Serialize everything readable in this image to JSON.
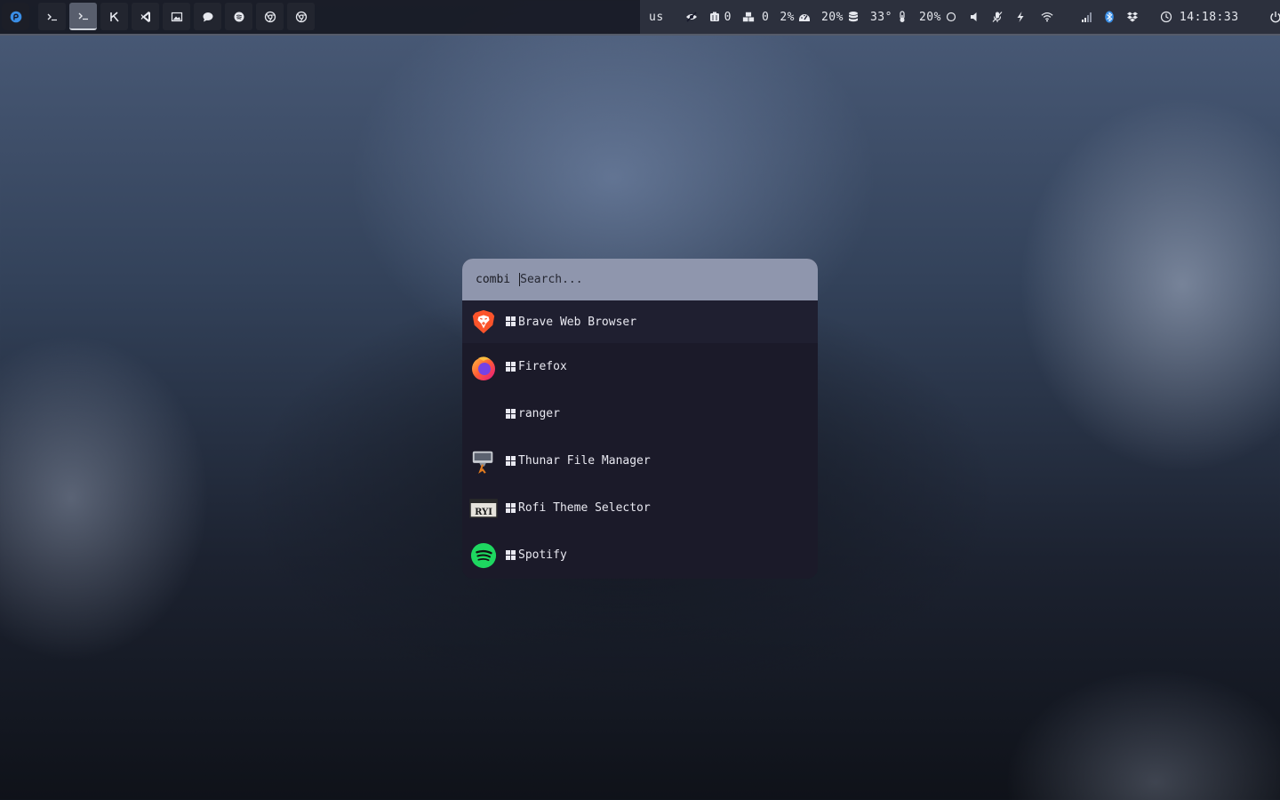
{
  "topbar": {
    "workspaces": [
      {
        "name": "terminal-icon",
        "active": false
      },
      {
        "name": "terminal-icon",
        "active": true
      },
      {
        "name": "kde-connect-icon",
        "active": false
      },
      {
        "name": "vscode-icon",
        "active": false
      },
      {
        "name": "image-icon",
        "active": false
      },
      {
        "name": "chat-icon",
        "active": false
      },
      {
        "name": "spotify-icon",
        "active": false
      },
      {
        "name": "chrome-icon",
        "active": false
      },
      {
        "name": "chrome-icon",
        "active": false
      }
    ],
    "status": {
      "keyboard_layout": "us",
      "hidden_count": "",
      "updates": "0",
      "packages": "0",
      "cpu": "2%",
      "memory": "20%",
      "temperature": "33°",
      "brightness": "20%",
      "time": "14:18:33"
    }
  },
  "launcher": {
    "prompt": "combi",
    "placeholder": "Search...",
    "items": [
      {
        "label": "Brave Web Browser",
        "icon": "brave-icon"
      },
      {
        "label": "Firefox",
        "icon": "firefox-icon"
      },
      {
        "label": "ranger",
        "icon": ""
      },
      {
        "label": "Thunar File Manager",
        "icon": "thunar-icon"
      },
      {
        "label": "Rofi Theme Selector",
        "icon": "rofi-icon"
      },
      {
        "label": "Spotify",
        "icon": "spotify-icon"
      }
    ]
  },
  "colors": {
    "bar_bg": "#16182a",
    "launcher_bg": "#1b1a29",
    "search_bg": "#8f96ad",
    "accent_blue": "#3a8ee6",
    "spotify_green": "#1ed760",
    "brave_orange": "#fb542b"
  }
}
